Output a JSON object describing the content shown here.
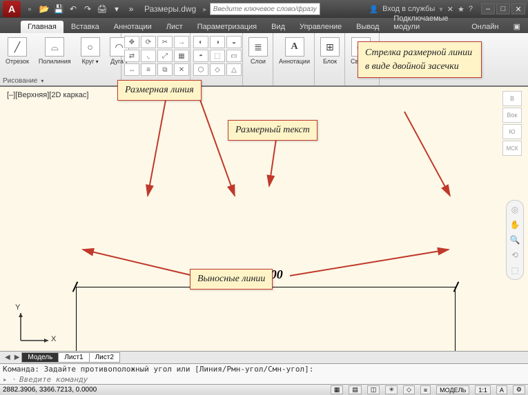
{
  "app": {
    "logo_letter": "A",
    "doc_title": "Размеры.dwg"
  },
  "qat_icons": [
    "new",
    "open",
    "save",
    "undo",
    "redo",
    "plot",
    "more",
    "expand"
  ],
  "search": {
    "placeholder": "Введите ключевое слово/фразу"
  },
  "signin": {
    "label": "Вход в службы"
  },
  "help_icons": [
    "exchange",
    "help"
  ],
  "win": {
    "min": "–",
    "max": "□",
    "close": "✕"
  },
  "tabs": [
    "Главная",
    "Вставка",
    "Аннотации",
    "Лист",
    "Параметризация",
    "Вид",
    "Управление",
    "Вывод",
    "Подключаемые модули",
    "Онлайн"
  ],
  "active_tab": 0,
  "ribbon": {
    "draw_panel_title": "Рисование",
    "draw_buttons": [
      {
        "label": "Отрезок",
        "icon": "╱"
      },
      {
        "label": "Полилиния",
        "icon": "⌓"
      },
      {
        "label": "Круг",
        "icon": "○"
      },
      {
        "label": "Дуга",
        "icon": "◠"
      }
    ],
    "layers_label": "Слои",
    "annotation_label": "Аннотации",
    "block_label": "Блок",
    "properties_label": "Свойст"
  },
  "view_label": "[–][Верхняя][2D каркас]",
  "dimension_value": "100,00",
  "callouts": {
    "dim_line": "Размерная линия",
    "dim_text": "Размерный текст",
    "ext_lines": "Выносные линии",
    "arrow_style": "Стрелка размерной линии в виде двойной засечки"
  },
  "view_cube": {
    "top": "В",
    "front": "Вок",
    "wcs": "Ю",
    "coord": "МСК"
  },
  "ucs": {
    "x": "X",
    "y": "Y"
  },
  "model_tabs": [
    "Модель",
    "Лист1",
    "Лист2"
  ],
  "active_model_tab": 0,
  "command_history": "Команда: Задайте противоположный угол или [Линия/Рмн-угол/Смн-угол]:",
  "command_placeholder": "Введите команду",
  "status": {
    "coords": "2882.3906, 3366.7213, 0.0000",
    "model_btn": "МОДЕЛЬ",
    "scale": "1:1"
  }
}
